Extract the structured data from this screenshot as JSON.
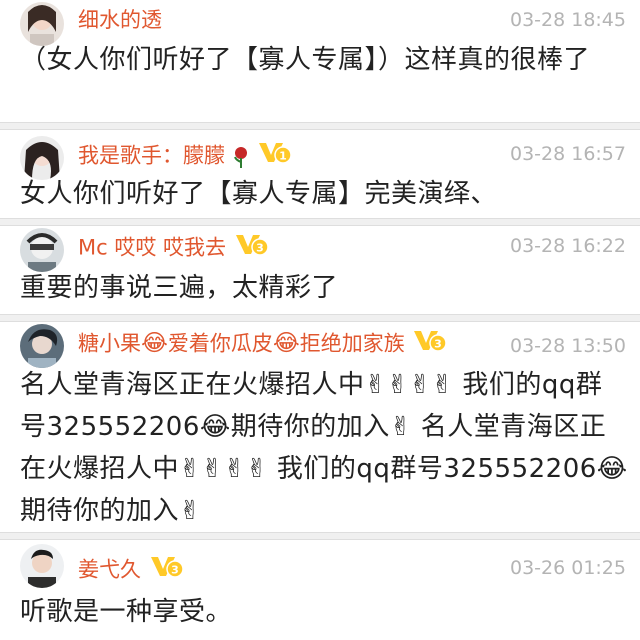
{
  "comments": [
    {
      "user": "细水的透",
      "time": "03-28 18:45",
      "text": "（女人你们听好了【寡人专属】）这样真的很棒了"
    },
    {
      "user": "我是歌手：朦朦",
      "time": "03-28 16:57",
      "badge": "1",
      "text": "女人你们听好了【寡人专属】完美演绎、"
    },
    {
      "user": "Mc 哎哎 哎我去",
      "time": "03-28 16:22",
      "badge": "3",
      "text": "重要的事说三遍，太精彩了"
    },
    {
      "user_parts": [
        "糖小果",
        "爱着你瓜皮",
        "拒绝加家族"
      ],
      "time": "03-28 13:50",
      "badge": "3",
      "text": "名人堂青海区正在火爆招人中✌✌✌✌ 我们的qq群号325552206😂期待你的加入✌ 名人堂青海区正在火爆招人中✌✌✌✌ 我们的qq群号325552206😂期待你的加入✌"
    },
    {
      "user": "姜弋久",
      "time": "03-26 01:25",
      "badge": "3",
      "text": "听歌是一种享受。"
    }
  ],
  "icons": {
    "rose": "rose-icon",
    "laugh": "tears-of-joy-icon",
    "victory": "victory-hand-icon",
    "vip": "vip-badge-icon"
  },
  "colors": {
    "username": "#e0572f",
    "time": "#b4b4b4",
    "text": "#222222",
    "vip": "#ffd54a"
  }
}
